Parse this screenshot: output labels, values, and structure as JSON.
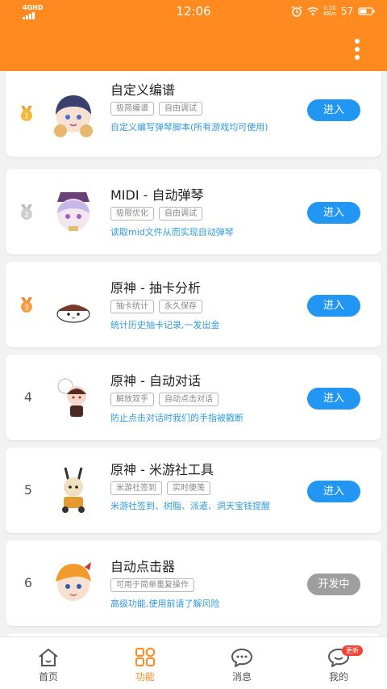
{
  "colors": {
    "accent": "#ff8a1f",
    "button": "#2196f3",
    "button_dev": "#9e9e9e",
    "desc": "#2f9be2"
  },
  "status_bar": {
    "network": "4GHD",
    "time": "12:06",
    "speed_value": "0.10",
    "speed_unit": "KB/s",
    "battery": "57"
  },
  "cards": [
    {
      "rank": "1",
      "title": "自定义编谱",
      "tags": [
        "极简编谱",
        "自由调试"
      ],
      "description": "自定义编写弹琴脚本(所有游戏均可使用)",
      "button": "进入"
    },
    {
      "rank": "2",
      "title": "MIDI - 自动弹琴",
      "tags": [
        "极限优化",
        "自由调试"
      ],
      "description": "读取mid文件从而实现自动弹琴",
      "button": "进入"
    },
    {
      "rank": "3",
      "title": "原神 - 抽卡分析",
      "tags": [
        "抽卡统计",
        "永久保存"
      ],
      "description": "统计历史抽卡记录,一发出金",
      "button": "进入"
    },
    {
      "rank": "4",
      "title": "原神 - 自动对话",
      "tags": [
        "解放双手",
        "自动点击对话"
      ],
      "description": "防止点击对话时我们的手指被戳断",
      "button": "进入"
    },
    {
      "rank": "5",
      "title": "原神 - 米游社工具",
      "tags": [
        "米游社签到",
        "实时便笺"
      ],
      "description": "米游社签到、树脂、派遣、洞天宝钱提醒",
      "button": "进入"
    },
    {
      "rank": "6",
      "title": "自动点击器",
      "tags": [
        "可用于简单重复操作"
      ],
      "description": "高级功能,使用前请了解风险",
      "button": "开发中"
    }
  ],
  "tabs": [
    {
      "label": "首页",
      "icon": "home-icon"
    },
    {
      "label": "功能",
      "icon": "grid-icon"
    },
    {
      "label": "消息",
      "icon": "chat-icon"
    },
    {
      "label": "我的",
      "icon": "profile-icon",
      "badge": "更新"
    }
  ]
}
